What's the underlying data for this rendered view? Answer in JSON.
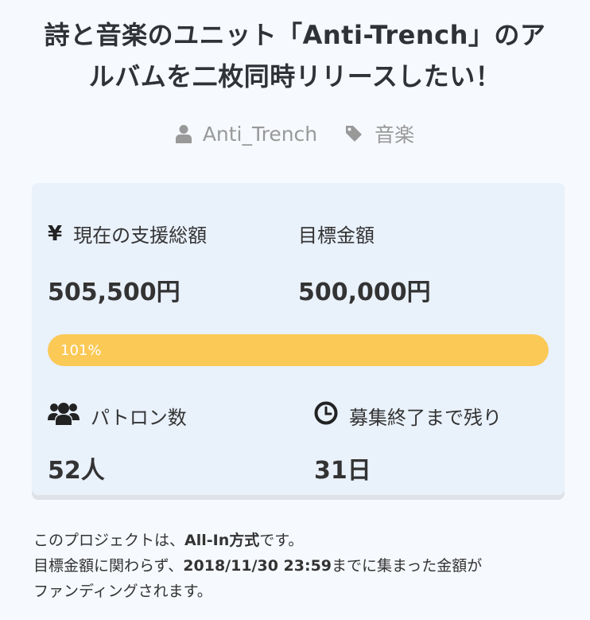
{
  "project": {
    "title_line1": "詩と音楽のユニット「Anti-Trench」のア",
    "title_line2": "ルバムを二枚同時リリースしたい！",
    "author": "Anti_Trench",
    "category": "音楽"
  },
  "funding": {
    "current_label": "現在の支援総額",
    "current_value": "505,500円",
    "goal_label": "目標金額",
    "goal_value": "500,000円",
    "progress_text": "101%",
    "progress_percent": 101,
    "backers_label": "パトロン数",
    "backers_value": "52人",
    "remaining_label": "募集終了まで残り",
    "remaining_value": "31日",
    "currency_symbol": "¥"
  },
  "description": {
    "line1_pre": "このプロジェクトは、",
    "line1_bold": "All-In方式",
    "line1_post": "です。",
    "line2_pre": "目標金額に関わらず、",
    "line2_bold": "2018/11/30 23:59",
    "line2_post": "までに集まった金額が",
    "line3": "ファンディングされます。"
  },
  "colors": {
    "accent": "#fbc956",
    "card_bg": "#e9f1fb",
    "meta_text": "#999999"
  },
  "icons": {
    "author": "user-icon",
    "category": "tag-icon",
    "backers": "users-icon",
    "remaining": "clock-icon"
  }
}
